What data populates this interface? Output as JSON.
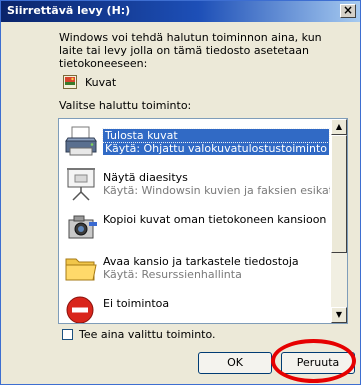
{
  "window": {
    "title": "Siirrettävä levy (H:)",
    "close_label": "×"
  },
  "intro_text": "Windows voi tehdä halutun toiminnon aina, kun laite tai levy jolla on tämä tiedosto asetetaan tietokoneeseen:",
  "content_type": {
    "label": "Kuvat",
    "icon": "pictures-icon"
  },
  "choose_label": "Valitse haluttu toiminto:",
  "actions": [
    {
      "name": "Tulosta kuvat",
      "sub": "Käytä: Ohjattu valokuvatulostustoiminto",
      "icon": "printer-icon",
      "selected": true
    },
    {
      "name": "Näytä diaesitys",
      "sub": "Käytä: Windowsin kuvien ja faksien esikatselu",
      "icon": "slideshow-projector-icon",
      "selected": false
    },
    {
      "name": "Kopioi kuvat oman tietokoneen kansioon",
      "sub": "",
      "icon": "camera-copy-icon",
      "selected": false
    },
    {
      "name": "Avaa kansio ja tarkastele tiedostoja",
      "sub": "Käytä: Resurssienhallinta",
      "icon": "folder-icon",
      "selected": false
    },
    {
      "name": "Ei toimintoa",
      "sub": "",
      "icon": "no-action-icon",
      "selected": false
    }
  ],
  "always_checkbox": {
    "label": "Tee aina valittu toiminto.",
    "checked": false
  },
  "buttons": {
    "ok": "OK",
    "cancel": "Peruuta"
  },
  "colors": {
    "selection": "#316ac5",
    "annotation": "#e60000"
  }
}
